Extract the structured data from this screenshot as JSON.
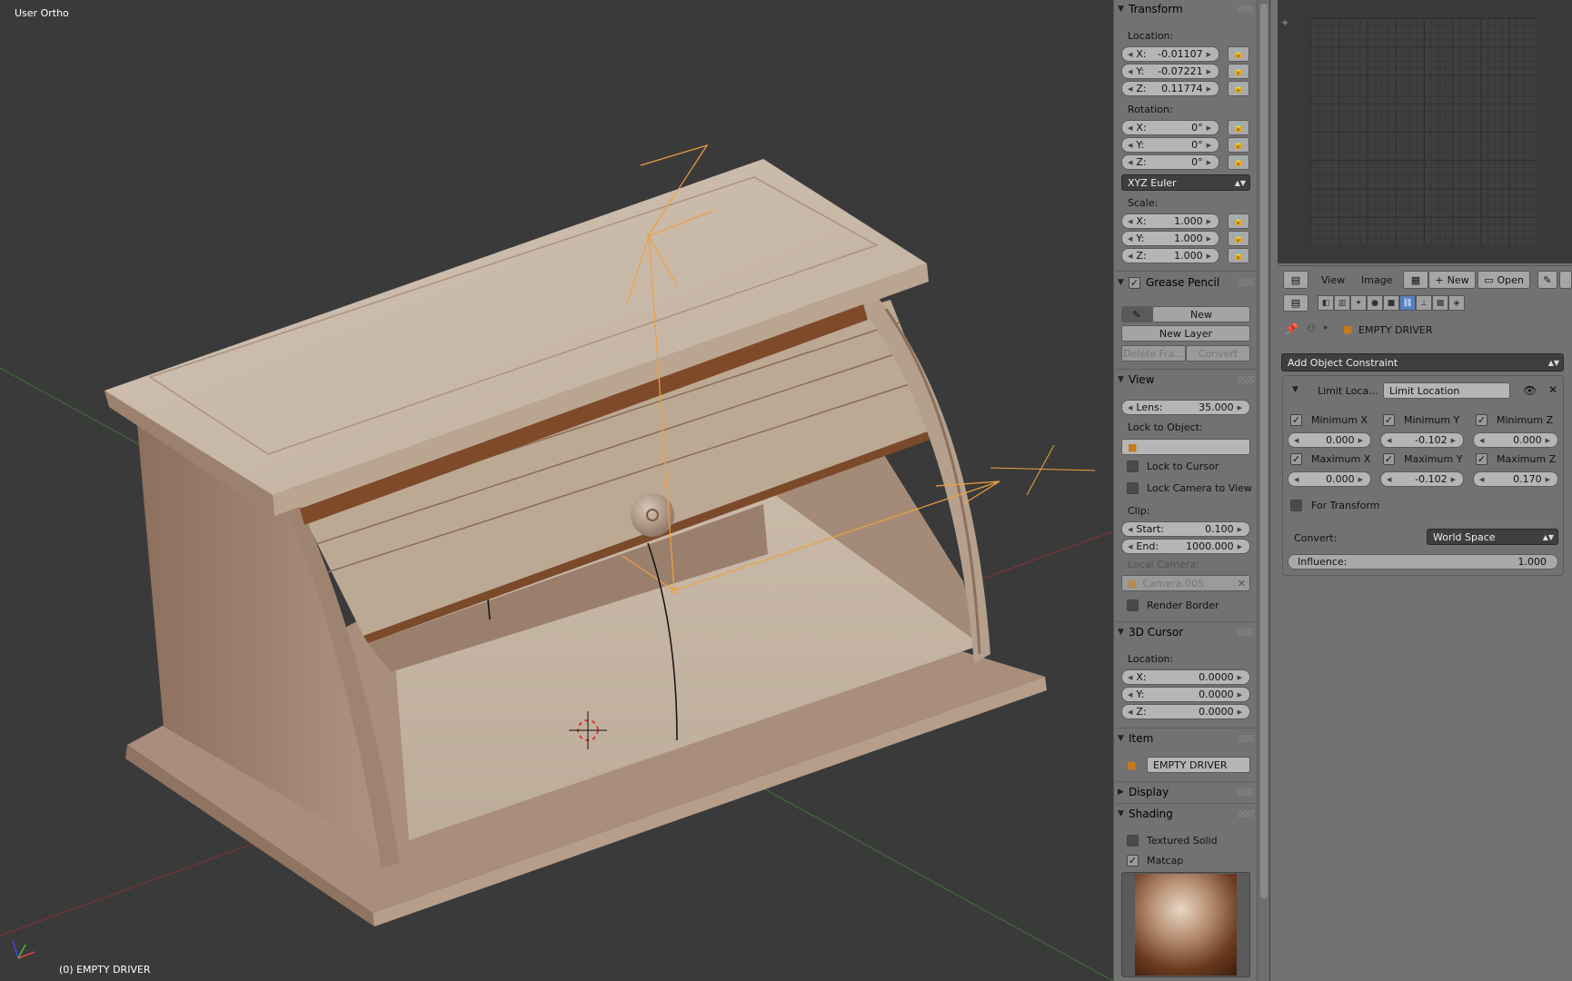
{
  "viewport": {
    "view_name": "User Ortho",
    "status_text": "(0) EMPTY DRIVER"
  },
  "npanel": {
    "transform": {
      "title": "Transform",
      "location_label": "Location:",
      "location": [
        {
          "axis": "X:",
          "value": "-0.01107"
        },
        {
          "axis": "Y:",
          "value": "-0.07221"
        },
        {
          "axis": "Z:",
          "value": "0.11774"
        }
      ],
      "rotation_label": "Rotation:",
      "rotation": [
        {
          "axis": "X:",
          "value": "0°"
        },
        {
          "axis": "Y:",
          "value": "0°"
        },
        {
          "axis": "Z:",
          "value": "0°"
        }
      ],
      "rotation_mode": "XYZ Euler",
      "scale_label": "Scale:",
      "scale": [
        {
          "axis": "X:",
          "value": "1.000"
        },
        {
          "axis": "Y:",
          "value": "1.000"
        },
        {
          "axis": "Z:",
          "value": "1.000"
        }
      ]
    },
    "grease_pencil": {
      "title": "Grease Pencil",
      "new_label": "New",
      "new_layer_label": "New Layer",
      "delete_frame_label": "Delete Fra...",
      "convert_label": "Convert"
    },
    "view": {
      "title": "View",
      "lens_label": "Lens:",
      "lens_value": "35.000",
      "lock_to_object_label": "Lock to Object:",
      "lock_to_cursor_label": "Lock to Cursor",
      "lock_camera_label": "Lock Camera to View",
      "clip_label": "Clip:",
      "clip_start_label": "Start:",
      "clip_start_value": "0.100",
      "clip_end_label": "End:",
      "clip_end_value": "1000.000",
      "local_camera_label": "Local Camera:",
      "local_camera_value": "Camera.005",
      "render_border_label": "Render Border"
    },
    "cursor": {
      "title": "3D Cursor",
      "location_label": "Location:",
      "location": [
        {
          "axis": "X:",
          "value": "0.0000"
        },
        {
          "axis": "Y:",
          "value": "0.0000"
        },
        {
          "axis": "Z:",
          "value": "0.0000"
        }
      ]
    },
    "item": {
      "title": "Item",
      "name": "EMPTY DRIVER"
    },
    "display": {
      "title": "Display"
    },
    "shading": {
      "title": "Shading",
      "textured_solid_label": "Textured Solid",
      "matcap_label": "Matcap"
    }
  },
  "image_editor_header": {
    "view_menu": "View",
    "image_menu": "Image",
    "new_label": "New",
    "open_label": "Open"
  },
  "properties": {
    "breadcrumb_object": "EMPTY DRIVER",
    "add_constraint_label": "Add Object Constraint",
    "constraint": {
      "short_name": "Limit Loca...",
      "name": "Limit Location",
      "min_x_label": "Minimum X",
      "min_x_value": "0.000",
      "min_y_label": "Minimum Y",
      "min_y_value": "-0.102",
      "min_z_label": "Minimum Z",
      "min_z_value": "0.000",
      "max_x_label": "Maximum X",
      "max_x_value": "0.000",
      "max_y_label": "Maximum Y",
      "max_y_value": "-0.102",
      "max_z_label": "Maximum Z",
      "max_z_value": "0.170",
      "for_transform_label": "For Transform",
      "convert_label": "Convert:",
      "convert_value": "World Space",
      "influence_label": "Influence:",
      "influence_value": "1.000"
    }
  },
  "colors": {
    "viewport_bg": "#3a3a3a",
    "panel_bg": "#727272",
    "selection_orange": "#f0a040",
    "active_tab_blue": "#5680c2"
  }
}
